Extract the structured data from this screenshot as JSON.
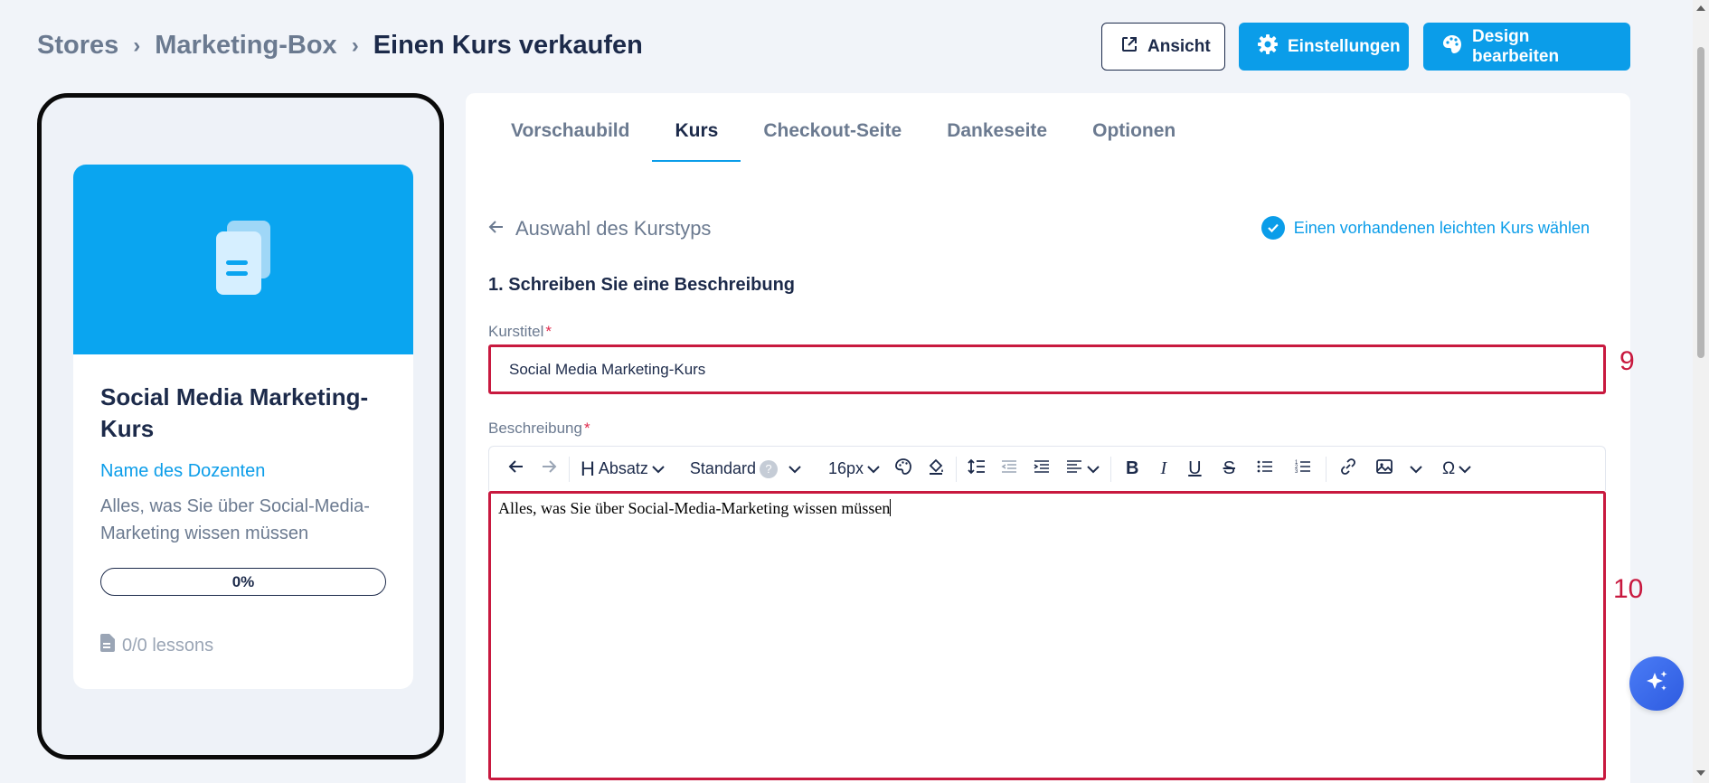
{
  "breadcrumb": {
    "items": [
      "Stores",
      "Marketing-Box"
    ],
    "current": "Einen Kurs verkaufen"
  },
  "header": {
    "view_label": "Ansicht",
    "settings_label": "Einstellungen",
    "design_label": "Design bearbeiten"
  },
  "preview": {
    "title": "Social Media Marketing-Kurs",
    "instructor": "Name des Dozenten",
    "description": "Alles, was Sie über Social-Media-Marketing wissen müssen",
    "progress_label": "0%",
    "lessons": "0/0 lessons"
  },
  "tabs": [
    "Vorschaubild",
    "Kurs",
    "Checkout-Seite",
    "Dankeseite",
    "Optionen"
  ],
  "active_tab": "Kurs",
  "form": {
    "back_label": "Auswahl des Kurstyps",
    "choose_existing": "Einen vorhandenen leichten Kurs wählen",
    "section_title": "1. Schreiben Sie eine Beschreibung",
    "title_label": "Kurstitel",
    "title_value": "Social Media Marketing-Kurs",
    "description_label": "Beschreibung",
    "required_mark": "*",
    "description_value": "Alles, was Sie über Social-Media-Marketing wissen müssen"
  },
  "toolbar": {
    "heading": "Absatz",
    "font": "Standard",
    "help": "?",
    "size": "16px"
  },
  "annotations": {
    "title_marker": "9",
    "description_marker": "10"
  },
  "colors": {
    "primary": "#0b9de9",
    "annotation": "#c8193f",
    "text_dark": "#1c2a4a"
  }
}
